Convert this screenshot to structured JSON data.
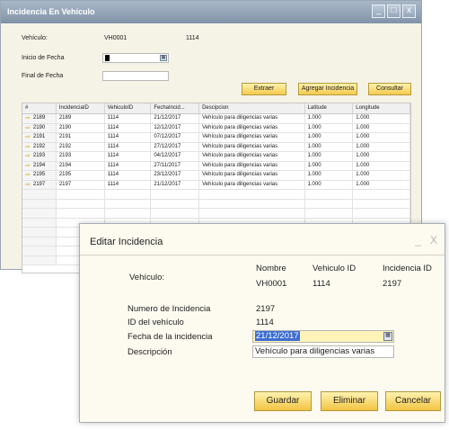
{
  "main_window": {
    "title": "Incidencia En Vehículo",
    "controls": [
      "_",
      "□",
      "x"
    ],
    "vehiculo_label": "Vehículo:",
    "vehiculo_id": "VH0001",
    "vehiculo_num": "1114",
    "inicio_label": "Inicio de Fecha",
    "final_label": "Final de Fecha",
    "buttons": {
      "extraer": "Extraer",
      "agregar": "Agregar Incidencia",
      "consultar": "Consultar"
    },
    "grid": {
      "columns": [
        "#",
        "IncidenciaID",
        "VehiculoID",
        "FechaIncid...",
        "Descipcion",
        "Latitude",
        "Longitude"
      ],
      "rows": [
        [
          "2189",
          "2189",
          "1114",
          "21/12/2017",
          "Vehículo para diligencias varias",
          "1.000",
          "1.000"
        ],
        [
          "2190",
          "2190",
          "1114",
          "12/12/2017",
          "Vehículo para diligencias varias",
          "1.000",
          "1.000"
        ],
        [
          "2191",
          "2191",
          "1114",
          "07/12/2017",
          "Vehículo para diligencias varias",
          "1.000",
          "1.000"
        ],
        [
          "2192",
          "2192",
          "1114",
          "27/12/2017",
          "Vehículo para diligencias varias",
          "1.000",
          "1.000"
        ],
        [
          "2193",
          "2193",
          "1114",
          "04/12/2017",
          "Vehículo para diligencias varias",
          "1.000",
          "1.000"
        ],
        [
          "2194",
          "2194",
          "1114",
          "27/11/2017",
          "Vehículo para diligencias varias",
          "1.000",
          "1.000"
        ],
        [
          "2195",
          "2195",
          "1114",
          "23/12/2017",
          "Vehículo para diligencias varias",
          "1.000",
          "1.000"
        ],
        [
          "2197",
          "2197",
          "1114",
          "21/12/2017",
          "Vehículo para diligencias varias",
          "1.000",
          "1.000"
        ]
      ]
    }
  },
  "dialog": {
    "title": "Editar Incidencia",
    "controls": [
      "_",
      "X"
    ],
    "vehiculo_label": "Vehículo:",
    "headers": {
      "nombre": "Nombre",
      "vehiculo_id": "Vehiculo ID",
      "incidencia_id": "Incidencia ID"
    },
    "values": {
      "nombre": "VH0001",
      "vehiculo_id": "1114",
      "incidencia_id": "2197"
    },
    "numero_label": "Numero de Incidencia",
    "numero_value": "2197",
    "id_vehiculo_label": "ID del vehículo",
    "id_vehiculo_value": "1114",
    "fecha_label": "Fecha de la incidencia",
    "fecha_value": "21/12/2017",
    "descripcion_label": "Descripción",
    "descripcion_value": "Vehículo para diligencias varias",
    "buttons": {
      "guardar": "Guardar",
      "eliminar": "Eliminar",
      "cancelar": "Cancelar"
    }
  }
}
